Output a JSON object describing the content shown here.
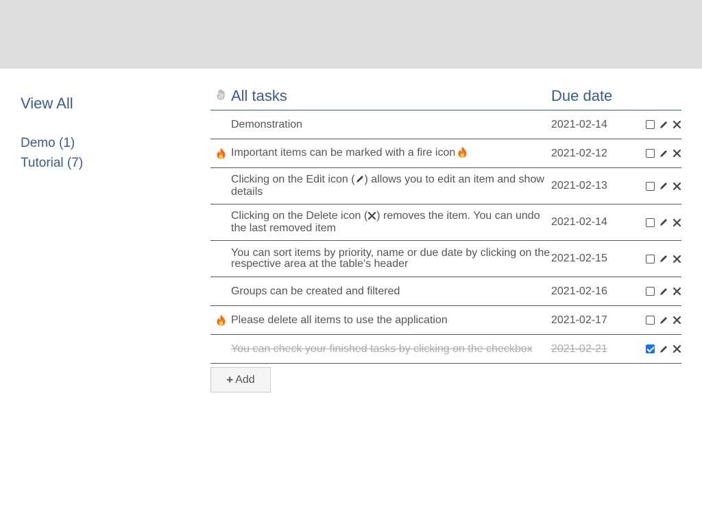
{
  "sidebar": {
    "view_all": "View All",
    "groups": [
      {
        "label": "Demo (1)"
      },
      {
        "label": "Tutorial (7)"
      }
    ]
  },
  "table": {
    "header_name": "All tasks",
    "header_date": "Due date",
    "rows": [
      {
        "name": "Demonstration",
        "date": "2021-02-14",
        "fire": false,
        "done": false
      },
      {
        "name": "Important items can be marked with a fire icon",
        "date": "2021-02-12",
        "fire": true,
        "done": false
      },
      {
        "name_pre": "Clicking on the Edit icon (",
        "name_post": ") allows you to edit an item and show details",
        "date": "2021-02-13",
        "fire": false,
        "done": false
      },
      {
        "name_pre": "Clicking on the Delete icon (",
        "name_post": ") removes the item. You can undo the last removed item",
        "date": "2021-02-14",
        "fire": false,
        "done": false
      },
      {
        "name": "You can sort items by priority, name or due date by clicking on the respective area at the table's header",
        "date": "2021-02-15",
        "fire": false,
        "done": false
      },
      {
        "name": "Groups can be created and filtered",
        "date": "2021-02-16",
        "fire": false,
        "done": false
      },
      {
        "name": "Please delete all items to use the application",
        "date": "2021-02-17",
        "fire": true,
        "done": false
      },
      {
        "name": "You can check your finished tasks by clicking on the checkbox",
        "date": "2021-02-21",
        "fire": false,
        "done": true
      }
    ]
  },
  "add_button": {
    "plus": "+",
    "label": "Add"
  },
  "icons": {
    "header_priority": "hand-icon",
    "fire": "fire-icon",
    "edit": "pencil-icon",
    "delete": "close-icon"
  },
  "colors": {
    "topbar": "#dddddd",
    "accent": "#3a5a94",
    "text": "#555555",
    "done_text": "#aaaaaa",
    "checkbox_checked": "#1a73e8"
  }
}
